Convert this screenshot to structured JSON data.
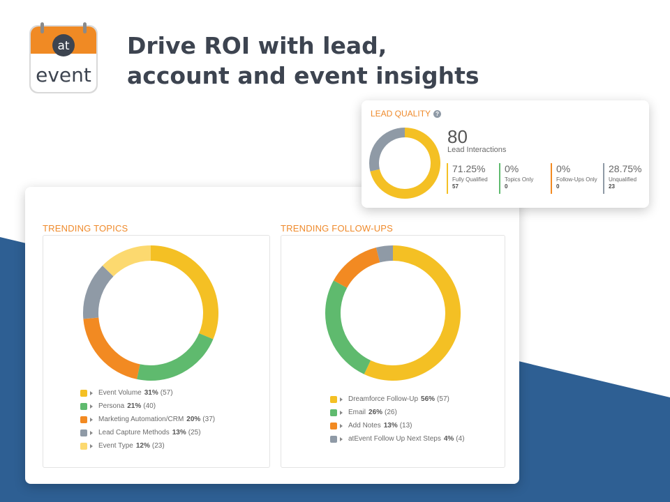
{
  "colors": {
    "accent": "#ef8a2b",
    "navy": "#2e5f93",
    "yellow": "#f4c024",
    "green": "#5fba6e",
    "orange": "#f28a22",
    "gray": "#8f9aa6",
    "light_yellow": "#fcd96f"
  },
  "logo": {
    "top_text": "at",
    "bottom_text": "event",
    "icon": "calendar-icon"
  },
  "headline": {
    "line1": "Drive ROI with lead,",
    "line2": "account and event insights"
  },
  "lead_quality": {
    "title": "LEAD QUALITY",
    "total": "80",
    "total_label": "Lead Interactions",
    "segments": [
      {
        "label": "Fully Qualified",
        "percent": "71.25%",
        "count": "57",
        "value": 71.25,
        "color": "#f4c024"
      },
      {
        "label": "Topics Only",
        "percent": "0%",
        "count": "0",
        "value": 0,
        "color": "#5fba6e"
      },
      {
        "label": "Follow-Ups Only",
        "percent": "0%",
        "count": "0",
        "value": 0,
        "color": "#f28a22"
      },
      {
        "label": "Unqualified",
        "percent": "28.75%",
        "count": "23",
        "value": 28.75,
        "color": "#8f9aa6"
      }
    ]
  },
  "trending_topics": {
    "title": "TRENDING TOPICS",
    "items": [
      {
        "label": "Event Volume",
        "pct": "31%",
        "count": "(57)",
        "value": 57,
        "color": "#f4c024"
      },
      {
        "label": "Persona",
        "pct": "21%",
        "count": "(40)",
        "value": 40,
        "color": "#5fba6e"
      },
      {
        "label": "Marketing Automation/CRM",
        "pct": "20%",
        "count": "(37)",
        "value": 37,
        "color": "#f28a22"
      },
      {
        "label": "Lead Capture Methods",
        "pct": "13%",
        "count": "(25)",
        "value": 25,
        "color": "#8f9aa6"
      },
      {
        "label": "Event Type",
        "pct": "12%",
        "count": "(23)",
        "value": 23,
        "color": "#fcd96f"
      }
    ]
  },
  "trending_followups": {
    "title": "TRENDING FOLLOW-UPS",
    "items": [
      {
        "label": "Dreamforce Follow-Up",
        "pct": "56%",
        "count": "(57)",
        "value": 57,
        "color": "#f4c024"
      },
      {
        "label": "Email",
        "pct": "26%",
        "count": "(26)",
        "value": 26,
        "color": "#5fba6e"
      },
      {
        "label": "Add Notes",
        "pct": "13%",
        "count": "(13)",
        "value": 13,
        "color": "#f28a22"
      },
      {
        "label": "atEvent Follow Up Next Steps",
        "pct": "4%",
        "count": "(4)",
        "value": 4,
        "color": "#8f9aa6"
      }
    ]
  }
}
